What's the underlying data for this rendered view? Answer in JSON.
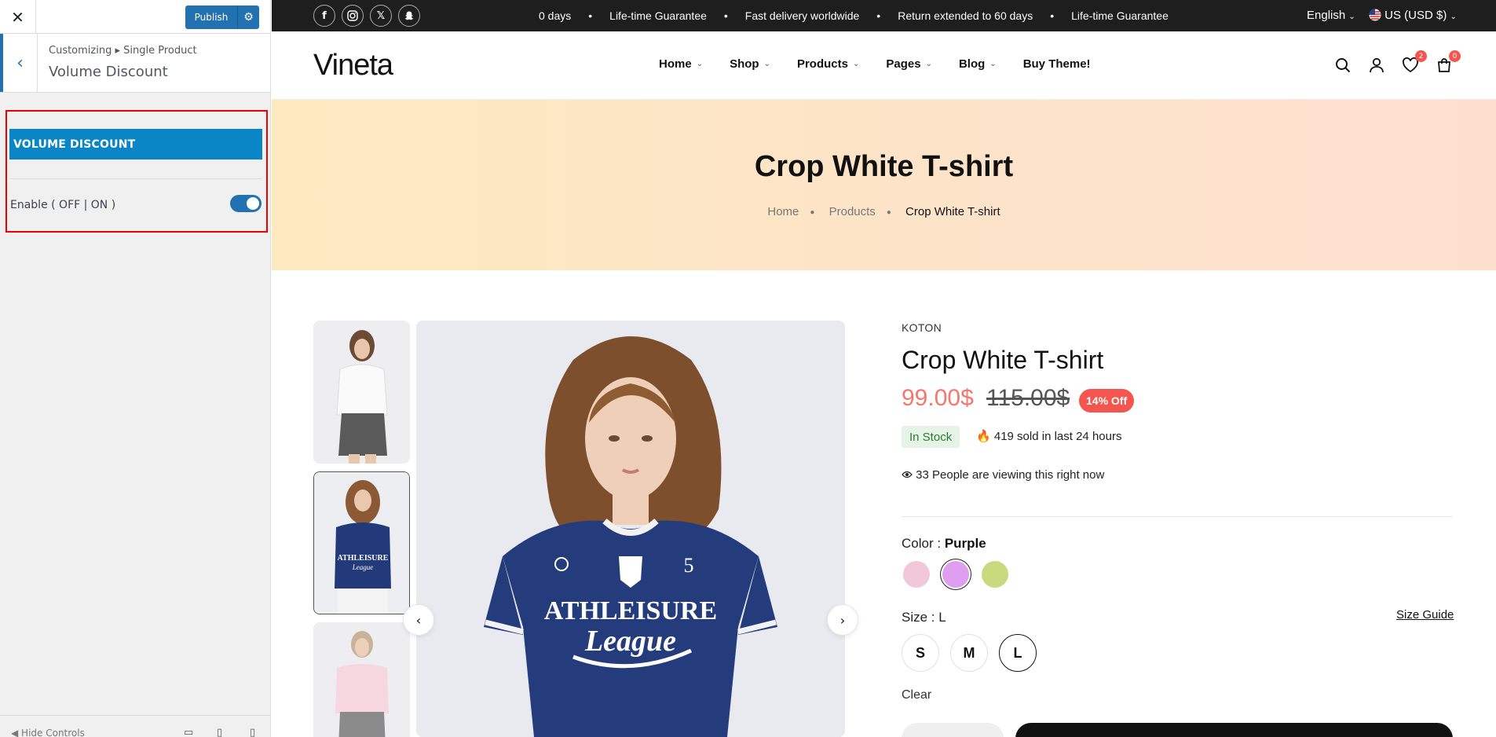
{
  "customizer": {
    "close_icon": "close-icon",
    "publish_label": "Publish",
    "breadcrumb": "Customizing ▸ Single Product",
    "title": "Volume Discount",
    "section_title": "VOLUME DISCOUNT",
    "enable_label": "Enable ( OFF | ON )",
    "enable_state": "on",
    "hide_controls": "Hide Controls",
    "accent_color": "#2271b1",
    "section_color": "#0a85c6"
  },
  "topbar": {
    "ticker": [
      "0 days",
      "Life-time Guarantee",
      "Fast delivery worldwide",
      "Return extended to 60 days",
      "Life-time Guarantee"
    ],
    "language": "English",
    "currency": "US (USD $)",
    "social_icons": [
      "facebook-icon",
      "instagram-icon",
      "x-icon",
      "snapchat-icon"
    ]
  },
  "header": {
    "logo": "Vineta",
    "nav": [
      "Home",
      "Shop",
      "Products",
      "Pages",
      "Blog",
      "Buy Theme!"
    ],
    "wishlist_count": "2",
    "cart_count": "0"
  },
  "hero": {
    "title": "Crop White T-shirt",
    "breadcrumb": [
      "Home",
      "Products",
      "Crop White T-shirt"
    ]
  },
  "product": {
    "brand": "KOTON",
    "title": "Crop White T-shirt",
    "price": "99.00$",
    "old_price": "115.00$",
    "discount": "14% Off",
    "stock": "In Stock",
    "sold": "419 sold in last 24 hours",
    "viewing": "33 People are viewing this right now",
    "color_label": "Color :",
    "color_value": "Purple",
    "colors": [
      "#f0c8d8",
      "#e09ef0",
      "#c8d97e"
    ],
    "size_label": "Size : L",
    "size_guide": "Size Guide",
    "sizes": [
      "S",
      "M",
      "L"
    ],
    "selected_size": "L",
    "clear": "Clear",
    "shirt_text_1": "ATHLEISURE",
    "shirt_text_2": "League",
    "shirt_number": "5"
  }
}
